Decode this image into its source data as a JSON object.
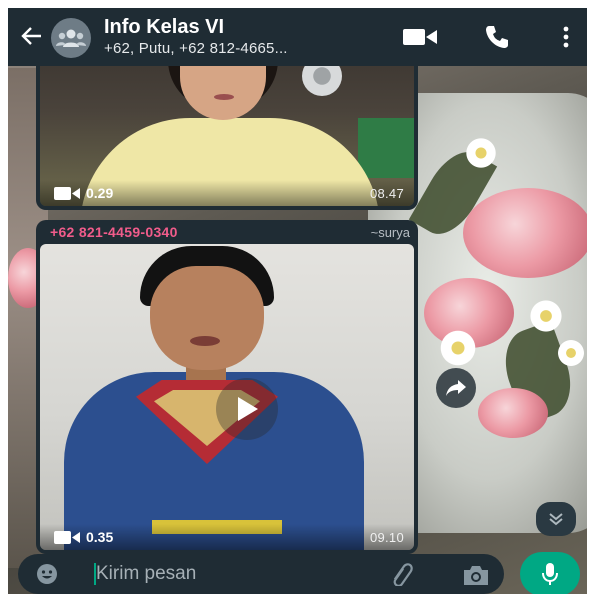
{
  "header": {
    "title": "Info Kelas VI",
    "subtitle": "+62, Putu, +62 812-4665..."
  },
  "messages": [
    {
      "type": "video",
      "duration": "0.29",
      "time": "08.47"
    },
    {
      "type": "video",
      "sender_phone": "+62 821-4459-0340",
      "sender_name": "~surya",
      "duration": "0.35",
      "time": "09.10"
    }
  ],
  "composer": {
    "placeholder": "Kirim pesan"
  },
  "colors": {
    "header_bg": "#1f2c34",
    "bubble_bg": "#1f2c34",
    "sender_phone": "#f15c8b",
    "accent": "#00a884"
  },
  "icons": [
    "back-arrow-icon",
    "group-avatar-icon",
    "video-call-icon",
    "call-icon",
    "menu-icon",
    "video-camera-icon",
    "play-icon",
    "forward-icon",
    "scroll-down-icon",
    "emoji-icon",
    "attach-icon",
    "camera-icon",
    "mic-icon"
  ]
}
